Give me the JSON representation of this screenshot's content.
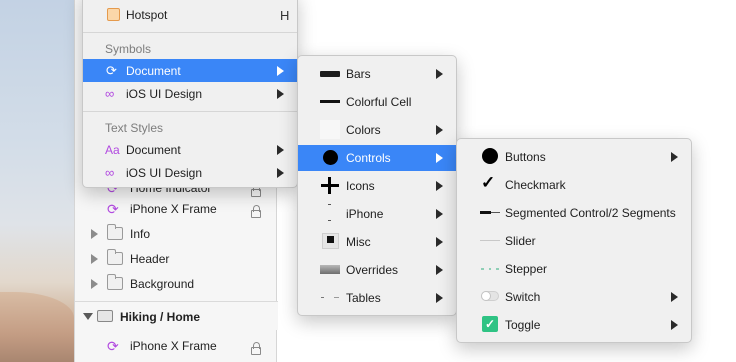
{
  "layers_panel": {
    "rows": [
      {
        "label": "Home Indicator"
      },
      {
        "label": "iPhone X Frame"
      },
      {
        "label": "Info"
      },
      {
        "label": "Header"
      },
      {
        "label": "Background"
      }
    ],
    "artboard": {
      "label": "Hiking / Home"
    },
    "artboard_child": {
      "label": "iPhone X Frame"
    }
  },
  "insert_menu": {
    "hotspot": {
      "label": "Hotspot",
      "shortcut": "H"
    },
    "symbols_header": "Symbols",
    "symbols": [
      {
        "label": "Document"
      },
      {
        "label": "iOS UI Design"
      }
    ],
    "text_styles_header": "Text Styles",
    "text_styles": [
      {
        "label": "Document"
      },
      {
        "label": "iOS UI Design"
      }
    ]
  },
  "document_submenu": {
    "items": [
      {
        "label": "Bars"
      },
      {
        "label": "Colorful Cell"
      },
      {
        "label": "Colors"
      },
      {
        "label": "Controls"
      },
      {
        "label": "Icons"
      },
      {
        "label": "iPhone"
      },
      {
        "label": "Misc"
      },
      {
        "label": "Overrides"
      },
      {
        "label": "Tables"
      }
    ]
  },
  "controls_submenu": {
    "items": [
      {
        "label": "Buttons"
      },
      {
        "label": "Checkmark"
      },
      {
        "label": "Segmented Control/2 Segments"
      },
      {
        "label": "Slider"
      },
      {
        "label": "Stepper"
      },
      {
        "label": "Switch"
      },
      {
        "label": "Toggle"
      }
    ]
  },
  "colors": {
    "selection": "#3a86f7",
    "symbol_purple": "#b24ae0",
    "toggle_green": "#2fc384"
  }
}
